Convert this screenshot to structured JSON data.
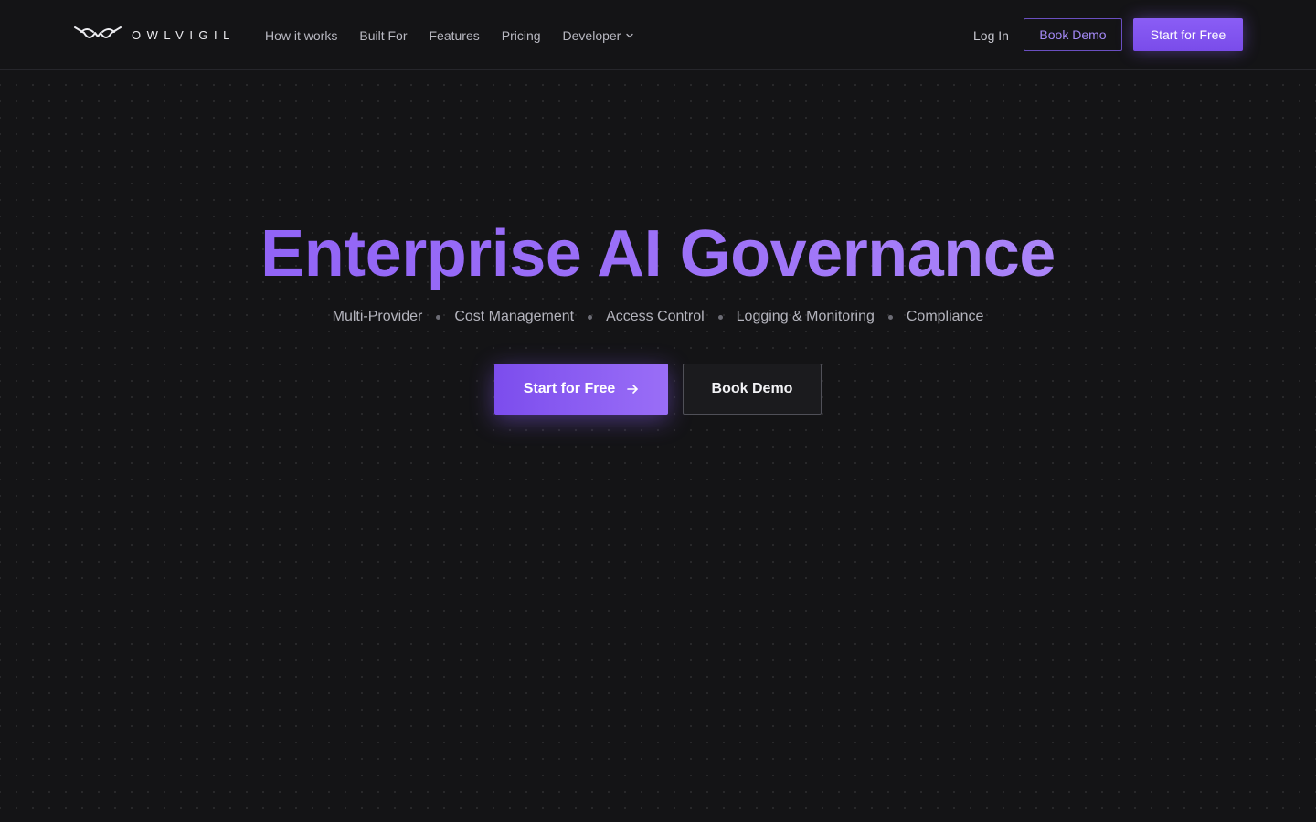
{
  "brand": {
    "name": "OWLVIGIL"
  },
  "nav": {
    "links": [
      "How it works",
      "Built For",
      "Features",
      "Pricing"
    ],
    "developer": "Developer",
    "login": "Log In",
    "book_demo": "Book Demo",
    "start_free": "Start for Free"
  },
  "hero": {
    "title": "Enterprise AI Governance",
    "features": [
      "Multi-Provider",
      "Cost Management",
      "Access Control",
      "Logging & Monitoring",
      "Compliance"
    ],
    "cta_primary": "Start for Free",
    "cta_secondary": "Book Demo"
  },
  "colors": {
    "background": "#141416",
    "accent": "#8b5cf6",
    "accent_light": "#a58af7"
  }
}
